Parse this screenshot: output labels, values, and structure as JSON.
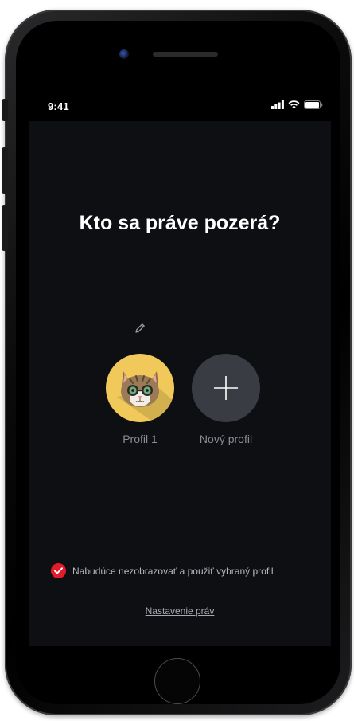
{
  "status_bar": {
    "time": "9:41"
  },
  "screen": {
    "title": "Kto sa práve pozerá?",
    "profiles": [
      {
        "label": "Profil 1",
        "avatar": "cat-with-glasses-icon"
      },
      {
        "label": "Nový profil",
        "icon": "plus-icon"
      }
    ],
    "edit_icon": "pencil-icon",
    "remember_checkbox": {
      "checked": true,
      "label": "Nabudúce nezobrazovať a použiť vybraný profil"
    },
    "settings_link": "Nastavenie práv"
  },
  "colors": {
    "background": "#0e0f13",
    "accent_red": "#e31b2b",
    "avatar_yellow": "#f0c95a",
    "add_circle": "#3a3c43"
  }
}
